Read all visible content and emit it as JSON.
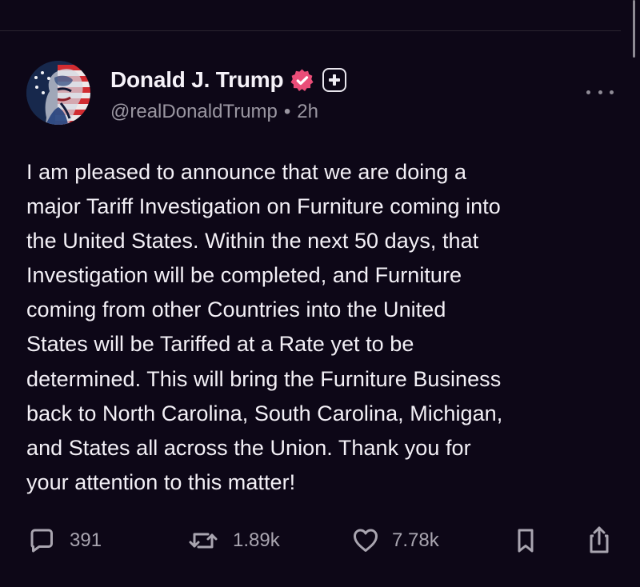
{
  "post": {
    "author": {
      "display_name": "Donald J. Trump",
      "handle": "@realDonaldTrump",
      "separator": "•",
      "time_ago": "2h",
      "avatar_icon": "flag-portrait-avatar",
      "verified_icon": "verified-badge-icon",
      "plus_icon": "plus-badge-icon"
    },
    "body_lines": [
      "I am pleased to announce that we are doing a",
      "major Tariff Investigation on Furniture coming into",
      "the United States. Within the next 50 days, that",
      "Investigation will be completed, and Furniture",
      "coming from other Countries into the United",
      "States will be Tariffed at a Rate yet to be",
      "determined. This will bring the Furniture Business",
      "back to North Carolina, South Carolina, Michigan,",
      "and States all across the Union. Thank you for",
      "your attention to this matter!"
    ],
    "actions": {
      "replies": "391",
      "reposts": "1.89k",
      "likes": "7.78k"
    }
  },
  "colors": {
    "background": "#0d0717",
    "text": "#f3f0f6",
    "muted": "#9a96a1",
    "verified_badge": "#ea4d78"
  }
}
